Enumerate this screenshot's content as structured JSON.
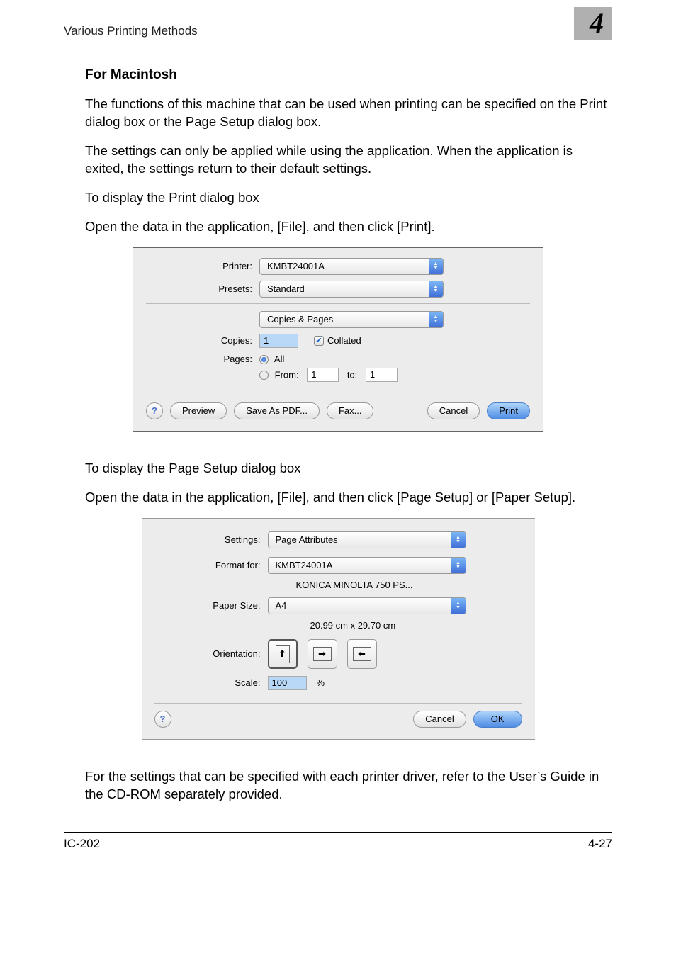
{
  "header": {
    "section": "Various Printing Methods",
    "chapter": "4"
  },
  "title": "For Macintosh",
  "paras": {
    "p1": "The functions of this machine that can be used when printing can be specified on the Print dialog box or the Page Setup dialog box.",
    "p2": "The settings can only be applied while using the application. When the application is exited, the settings return to their default settings.",
    "p3": "To display the Print dialog box",
    "p4": "Open the data in the application, [File], and then click [Print].",
    "p5": "To display the Page Setup dialog box",
    "p6": "Open the data in the application, [File], and then click [Page Setup] or [Paper Setup].",
    "p7": "For the settings that can be specified with each printer driver, refer to the User’s Guide in the CD-ROM separately provided."
  },
  "printDialog": {
    "labels": {
      "printer": "Printer:",
      "presets": "Presets:",
      "copies": "Copies:",
      "pages": "Pages:",
      "all": "All",
      "from": "From:",
      "to": "to:"
    },
    "printer": "KMBT24001A",
    "presets": "Standard",
    "pane": "Copies & Pages",
    "copies": "1",
    "collated": "Collated",
    "from": "1",
    "toVal": "1",
    "buttons": {
      "help": "?",
      "preview": "Preview",
      "savepdf": "Save As PDF...",
      "fax": "Fax...",
      "cancel": "Cancel",
      "print": "Print"
    }
  },
  "pageSetup": {
    "labels": {
      "settings": "Settings:",
      "formatFor": "Format for:",
      "paperSize": "Paper Size:",
      "orientation": "Orientation:",
      "scale": "Scale:"
    },
    "settings": "Page Attributes",
    "formatFor": "KMBT24001A",
    "formatSub": "KONICA MINOLTA 750 PS...",
    "paperSize": "A4",
    "paperDim": "20.99 cm x 29.70 cm",
    "scale": "100",
    "percent": "%",
    "buttons": {
      "help": "?",
      "cancel": "Cancel",
      "ok": "OK"
    }
  },
  "footer": {
    "left": "IC-202",
    "right": "4-27"
  }
}
